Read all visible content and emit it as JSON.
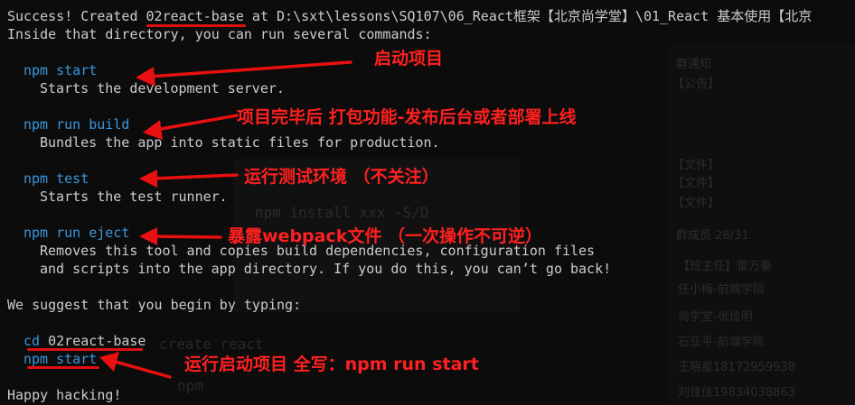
{
  "terminal": {
    "success_prefix": "Success! Created ",
    "project_name": "02react-base",
    "success_suffix": " at D:\\sxt\\lessons\\SQ107\\06_React框架【北京尚学堂】\\01_React 基本使用【北京",
    "inside_line": "Inside that directory, you can run several commands:",
    "commands": [
      {
        "cmd": "npm start",
        "desc": "Starts the development server."
      },
      {
        "cmd": "npm run build",
        "desc": "Bundles the app into static files for production."
      },
      {
        "cmd": "npm test",
        "desc": "Starts the test runner."
      },
      {
        "cmd": "npm run eject",
        "desc": "Removes this tool and copies build dependencies, configuration files",
        "desc2": "and scripts into the app directory. If you do this, you can’t go back!"
      }
    ],
    "suggest_line": "We suggest that you begin by typing:",
    "cd_cmd": "cd",
    "start_cmd": "npm start",
    "happy": "Happy hacking!"
  },
  "annotations": {
    "start": "启动项目",
    "build": "项目完毕后 打包功能-发布后台或者部署上线",
    "test": "运行测试环境 （不关注）",
    "eject": "暴露webpack文件 （一次操作不可逆）",
    "run_start": "运行启动项目  全写：npm run start"
  },
  "background_window": {
    "group_notice": "群通知",
    "notice_item": "【公告】",
    "files": [
      "【文件】",
      "【文件】",
      "【文件】"
    ],
    "members_label": "群成员 28/31",
    "members": [
      "【班主任】雷万秦",
      "任小梅-前端学院",
      "尚学堂-张佳明",
      "石亚平-前端学院",
      "王晓星18172959938",
      "刘佳佳19834038863"
    ],
    "code_lines": [
      "npm install xxx -S/D",
      "create react",
      "npm"
    ]
  },
  "colors": {
    "background": "#0c0c0c",
    "text": "#cccccc",
    "command": "#3a96dd",
    "annotation": "#ff2020"
  }
}
